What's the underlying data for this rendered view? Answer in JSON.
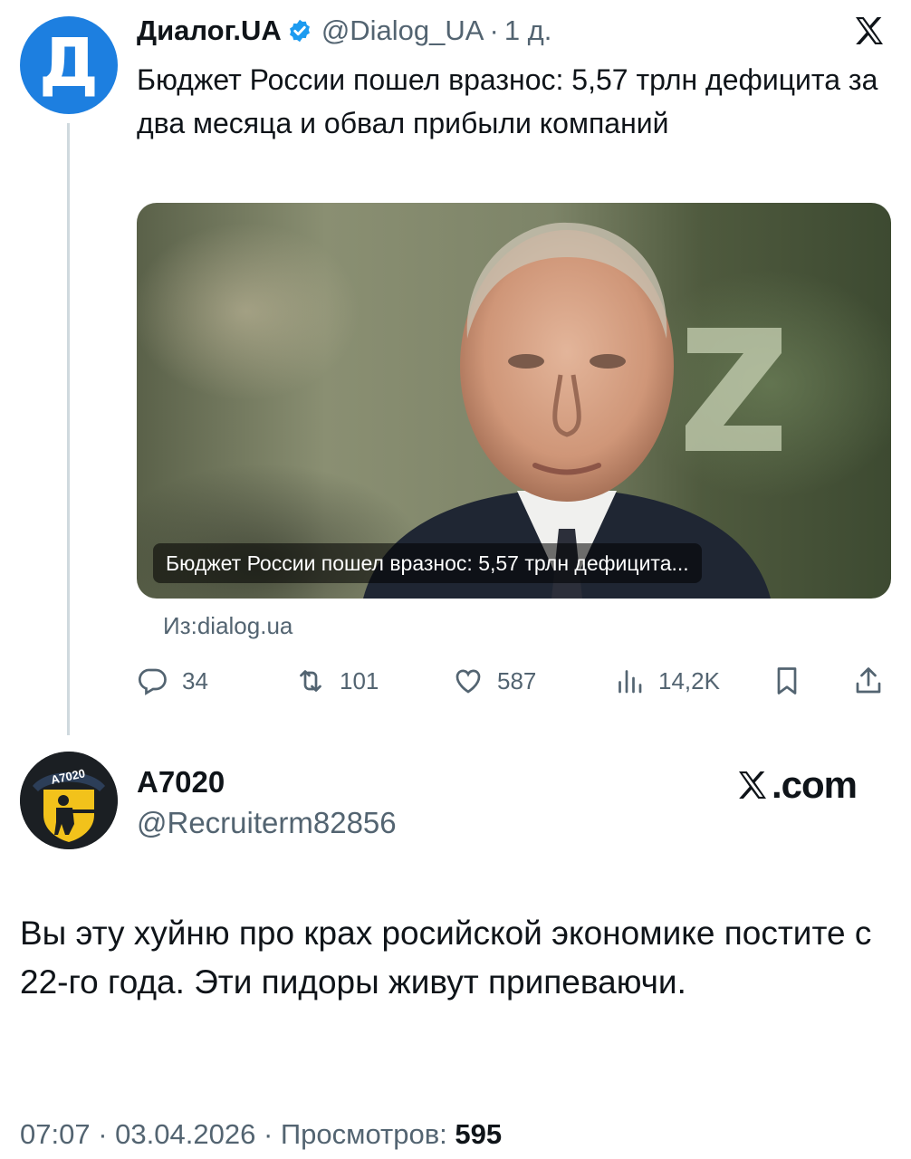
{
  "quoted": {
    "avatar_letter": "Д",
    "name": "Диалог.UA",
    "handle": "@Dialog_UA",
    "separator": "·",
    "time": "1 д.",
    "text": "Бюджет России пошел вразнос: 5,57 трлн дефицита за два месяца и обвал прибыли компаний",
    "card_caption": "Бюджет России пошел вразнос: 5,57 трлн дефицита...",
    "source": "Из:dialog.ua",
    "stats": {
      "replies": "34",
      "reposts": "101",
      "likes": "587",
      "views": "14,2K"
    }
  },
  "post": {
    "avatar_text": "A7020",
    "name": "A7020",
    "handle": "@Recruiterm82856",
    "brand": ".com",
    "text": "Вы эту хуйню про крах росийской экономике постите с 22-го года. Эти пидоры живут припеваючи.",
    "time": "07:07",
    "date": "03.04.2026",
    "separator": "·",
    "views_label": "Просмотров:",
    "views_count": "595"
  },
  "colors": {
    "accent": "#1d9bf0",
    "muted": "#536471",
    "text": "#0f1419",
    "avatar_blue": "#1d7fe0",
    "badge_yellow": "#f2c21b"
  },
  "icons": [
    "verified-badge-icon",
    "x-logo-icon",
    "reply-icon",
    "repost-icon",
    "like-icon",
    "views-icon",
    "bookmark-icon",
    "share-icon"
  ]
}
